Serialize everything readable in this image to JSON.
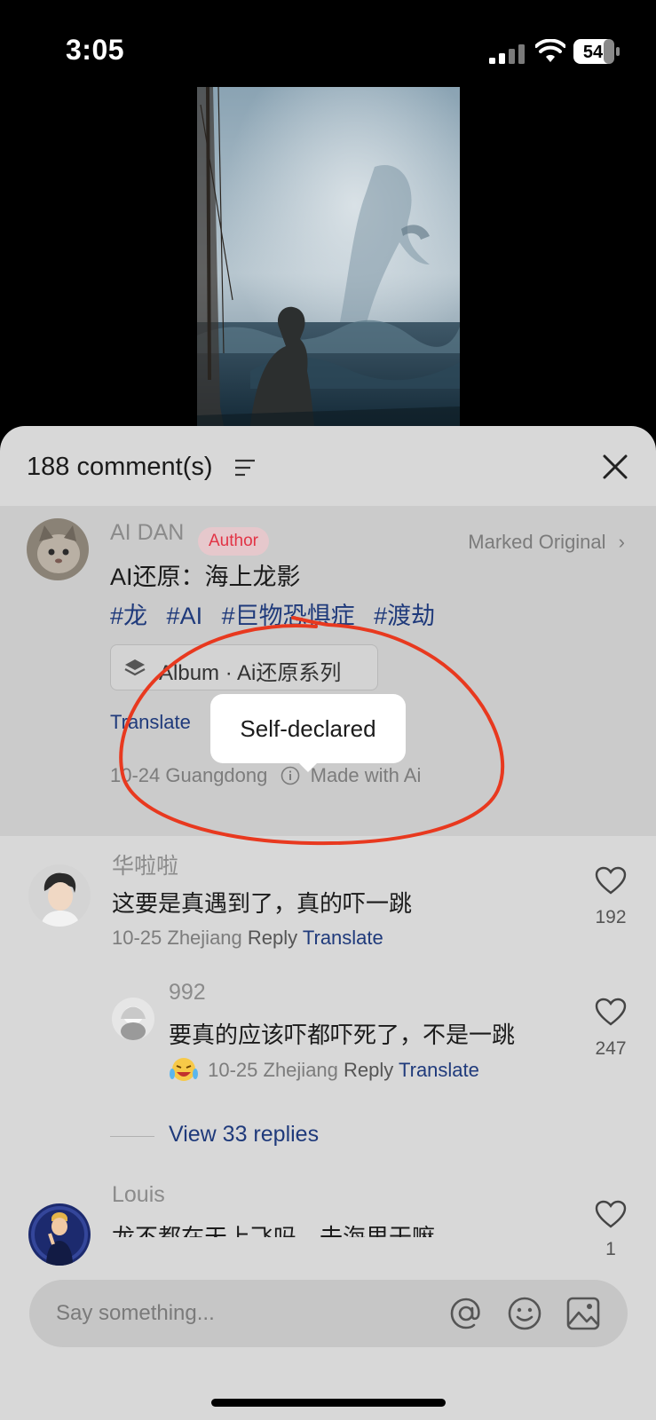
{
  "status_bar": {
    "time": "3:05",
    "battery": "54"
  },
  "sheet": {
    "comment_count": "188 comment(s)",
    "post": {
      "author": "AI DAN",
      "author_badge": "Author",
      "marked": "Marked Original",
      "title": "AI还原：海上龙影",
      "tags": [
        "#龙",
        "#AI",
        "#巨物恐惧症",
        "#渡劫"
      ],
      "album": "Album · Ai还原系列",
      "translate": "Translate",
      "meta_date_loc": "10-24 Guangdong",
      "made_with": "Made with Ai",
      "tooltip": "Self-declared"
    },
    "comments": [
      {
        "user": "华啦啦",
        "text": "这要是真遇到了，真的吓一跳",
        "date_loc": "10-25 Zhejiang",
        "reply": "Reply",
        "translate": "Translate",
        "likes": "192"
      },
      {
        "user": "992",
        "text": "要真的应该吓都吓死了，不是一跳",
        "date_loc": "10-25 Zhejiang",
        "reply": "Reply",
        "translate": "Translate",
        "likes": "247"
      },
      {
        "user": "Louis",
        "text": "龙不都在天上飞吗，去海里干嘛",
        "likes": "1"
      }
    ],
    "view_replies": "View 33 replies",
    "input_placeholder": "Say something..."
  }
}
